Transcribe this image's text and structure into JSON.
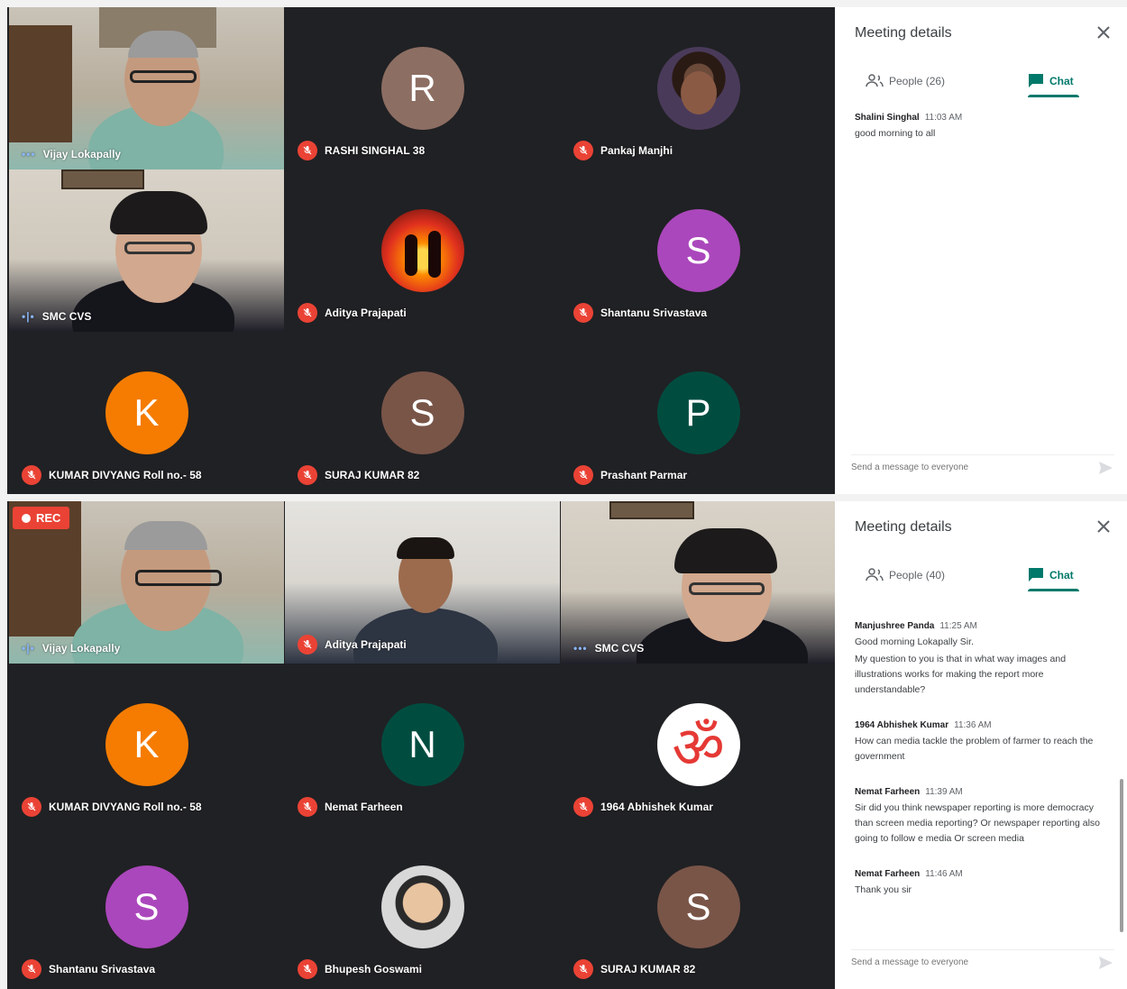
{
  "icons": {
    "mic_off": "mic-off-icon",
    "speaking": "speaking-indicator-icon",
    "close": "close-icon",
    "people": "people-icon",
    "chat": "chat-icon",
    "send": "send-icon"
  },
  "colors": {
    "background": "#202124",
    "mic_off": "#ea4335",
    "accent": "#00796b",
    "rec": "#ea4335"
  },
  "screen1": {
    "tiles": [
      {
        "name": "Vijay Lokapally",
        "initial": "",
        "status": "speaking",
        "speaking_glyph": "•••"
      },
      {
        "name": "RASHI SINGHAL 38",
        "initial": "R",
        "status": "muted"
      },
      {
        "name": "Pankaj Manjhi",
        "initial": "",
        "status": "muted"
      },
      {
        "name": "SMC CVS",
        "initial": "",
        "status": "speaking",
        "speaking_glyph": "•|•"
      },
      {
        "name": "Aditya Prajapati",
        "initial": "",
        "status": "muted"
      },
      {
        "name": "Shantanu Srivastava",
        "initial": "S",
        "status": "muted"
      },
      {
        "name": "KUMAR DIVYANG Roll no.- 58",
        "initial": "K",
        "status": "muted"
      },
      {
        "name": "SURAJ KUMAR 82",
        "initial": "S",
        "status": "muted"
      },
      {
        "name": "Prashant Parmar",
        "initial": "P",
        "status": "muted"
      }
    ],
    "panel": {
      "title": "Meeting details",
      "people_tab": "People (26)",
      "chat_tab": "Chat",
      "messages": [
        {
          "sender": "Shalini Singhal",
          "time": "11:03 AM",
          "lines": [
            "good morning to all"
          ]
        }
      ],
      "compose_placeholder": "Send a message to everyone"
    }
  },
  "screen2": {
    "rec_label": "REC",
    "tiles": [
      {
        "name": "Vijay Lokapally",
        "initial": "",
        "status": "speaking",
        "speaking_glyph": "•|•"
      },
      {
        "name": "Aditya Prajapati",
        "initial": "",
        "status": "muted"
      },
      {
        "name": "SMC CVS",
        "initial": "",
        "status": "speaking",
        "speaking_glyph": "•••"
      },
      {
        "name": "KUMAR DIVYANG Roll no.- 58",
        "initial": "K",
        "status": "muted"
      },
      {
        "name": "Nemat Farheen",
        "initial": "N",
        "status": "muted"
      },
      {
        "name": "1964 Abhishek Kumar",
        "initial": "ॐ",
        "status": "muted"
      },
      {
        "name": "Shantanu Srivastava",
        "initial": "S",
        "status": "muted"
      },
      {
        "name": "Bhupesh Goswami",
        "initial": "",
        "status": "muted"
      },
      {
        "name": "SURAJ KUMAR 82",
        "initial": "S",
        "status": "muted"
      }
    ],
    "panel": {
      "title": "Meeting details",
      "people_tab": "People (40)",
      "chat_tab": "Chat",
      "messages": [
        {
          "sender": "Manjushree Panda",
          "time": "11:25 AM",
          "lines": [
            "Good morning Lokapally Sir.",
            "My question to you is that in what way images and illustrations works for making the report more understandable?"
          ]
        },
        {
          "sender": "1964 Abhishek Kumar",
          "time": "11:36 AM",
          "lines": [
            "How can media  tackle the problem  of farmer to reach the government"
          ]
        },
        {
          "sender": "Nemat Farheen",
          "time": "11:39 AM",
          "lines": [
            "Sir did you think newspaper reporting is more democracy than screen media reporting? Or newspaper reporting also going to follow e media Or screen media"
          ]
        },
        {
          "sender": "Nemat Farheen",
          "time": "11:46 AM",
          "lines": [
            "Thank you sir"
          ]
        }
      ],
      "compose_placeholder": "Send a message to everyone"
    }
  }
}
